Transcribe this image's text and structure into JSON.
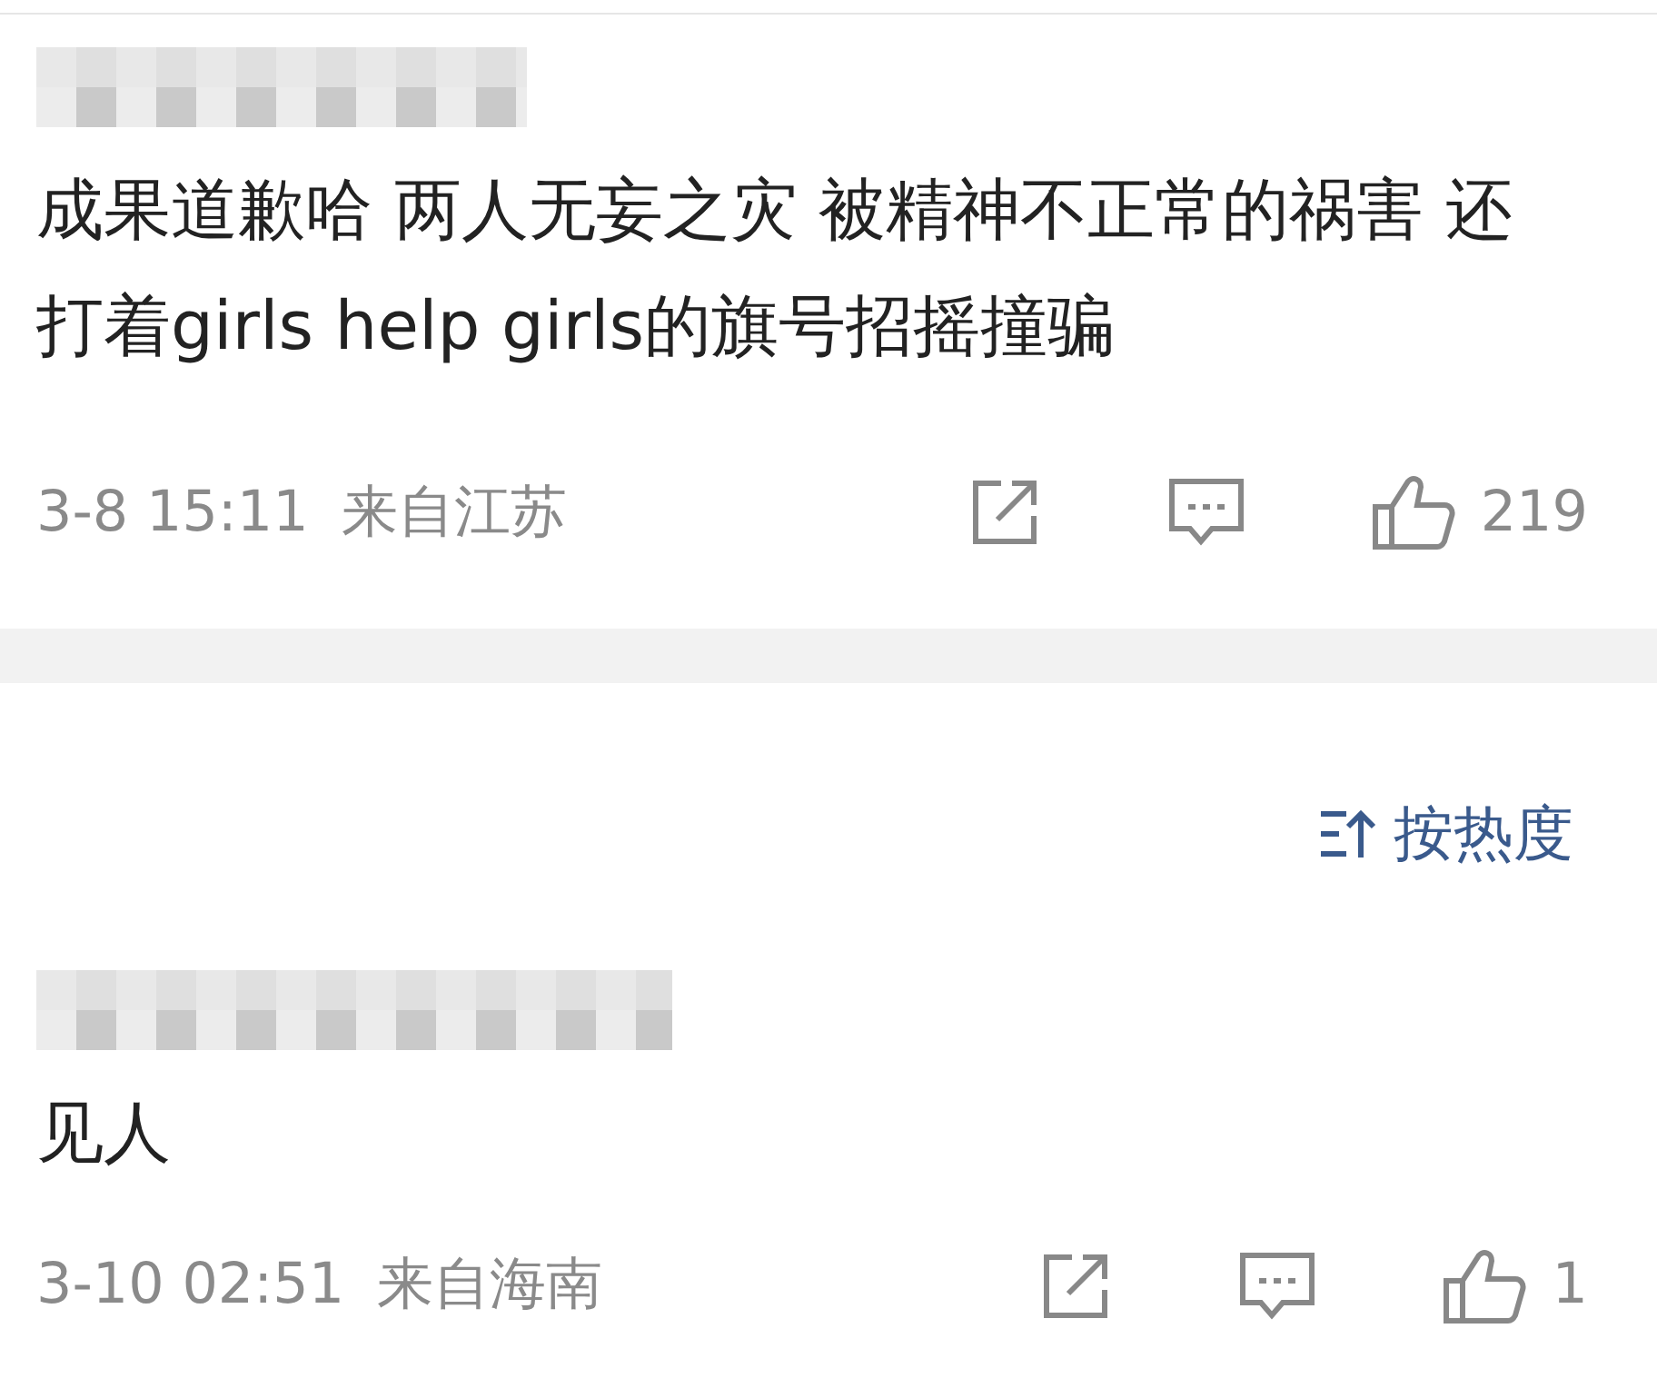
{
  "comments": [
    {
      "text": "成果道歉哈 两人无妄之灾 被精神不正常的祸害 还打着girls help girls的旗号招摇撞骗",
      "time": "3-8 15:11",
      "location": "来自江苏",
      "likes": "219"
    },
    {
      "text": "见人",
      "time": "3-10 02:51",
      "location": "来自海南",
      "likes": "1"
    }
  ],
  "sort": {
    "label": "按热度"
  }
}
